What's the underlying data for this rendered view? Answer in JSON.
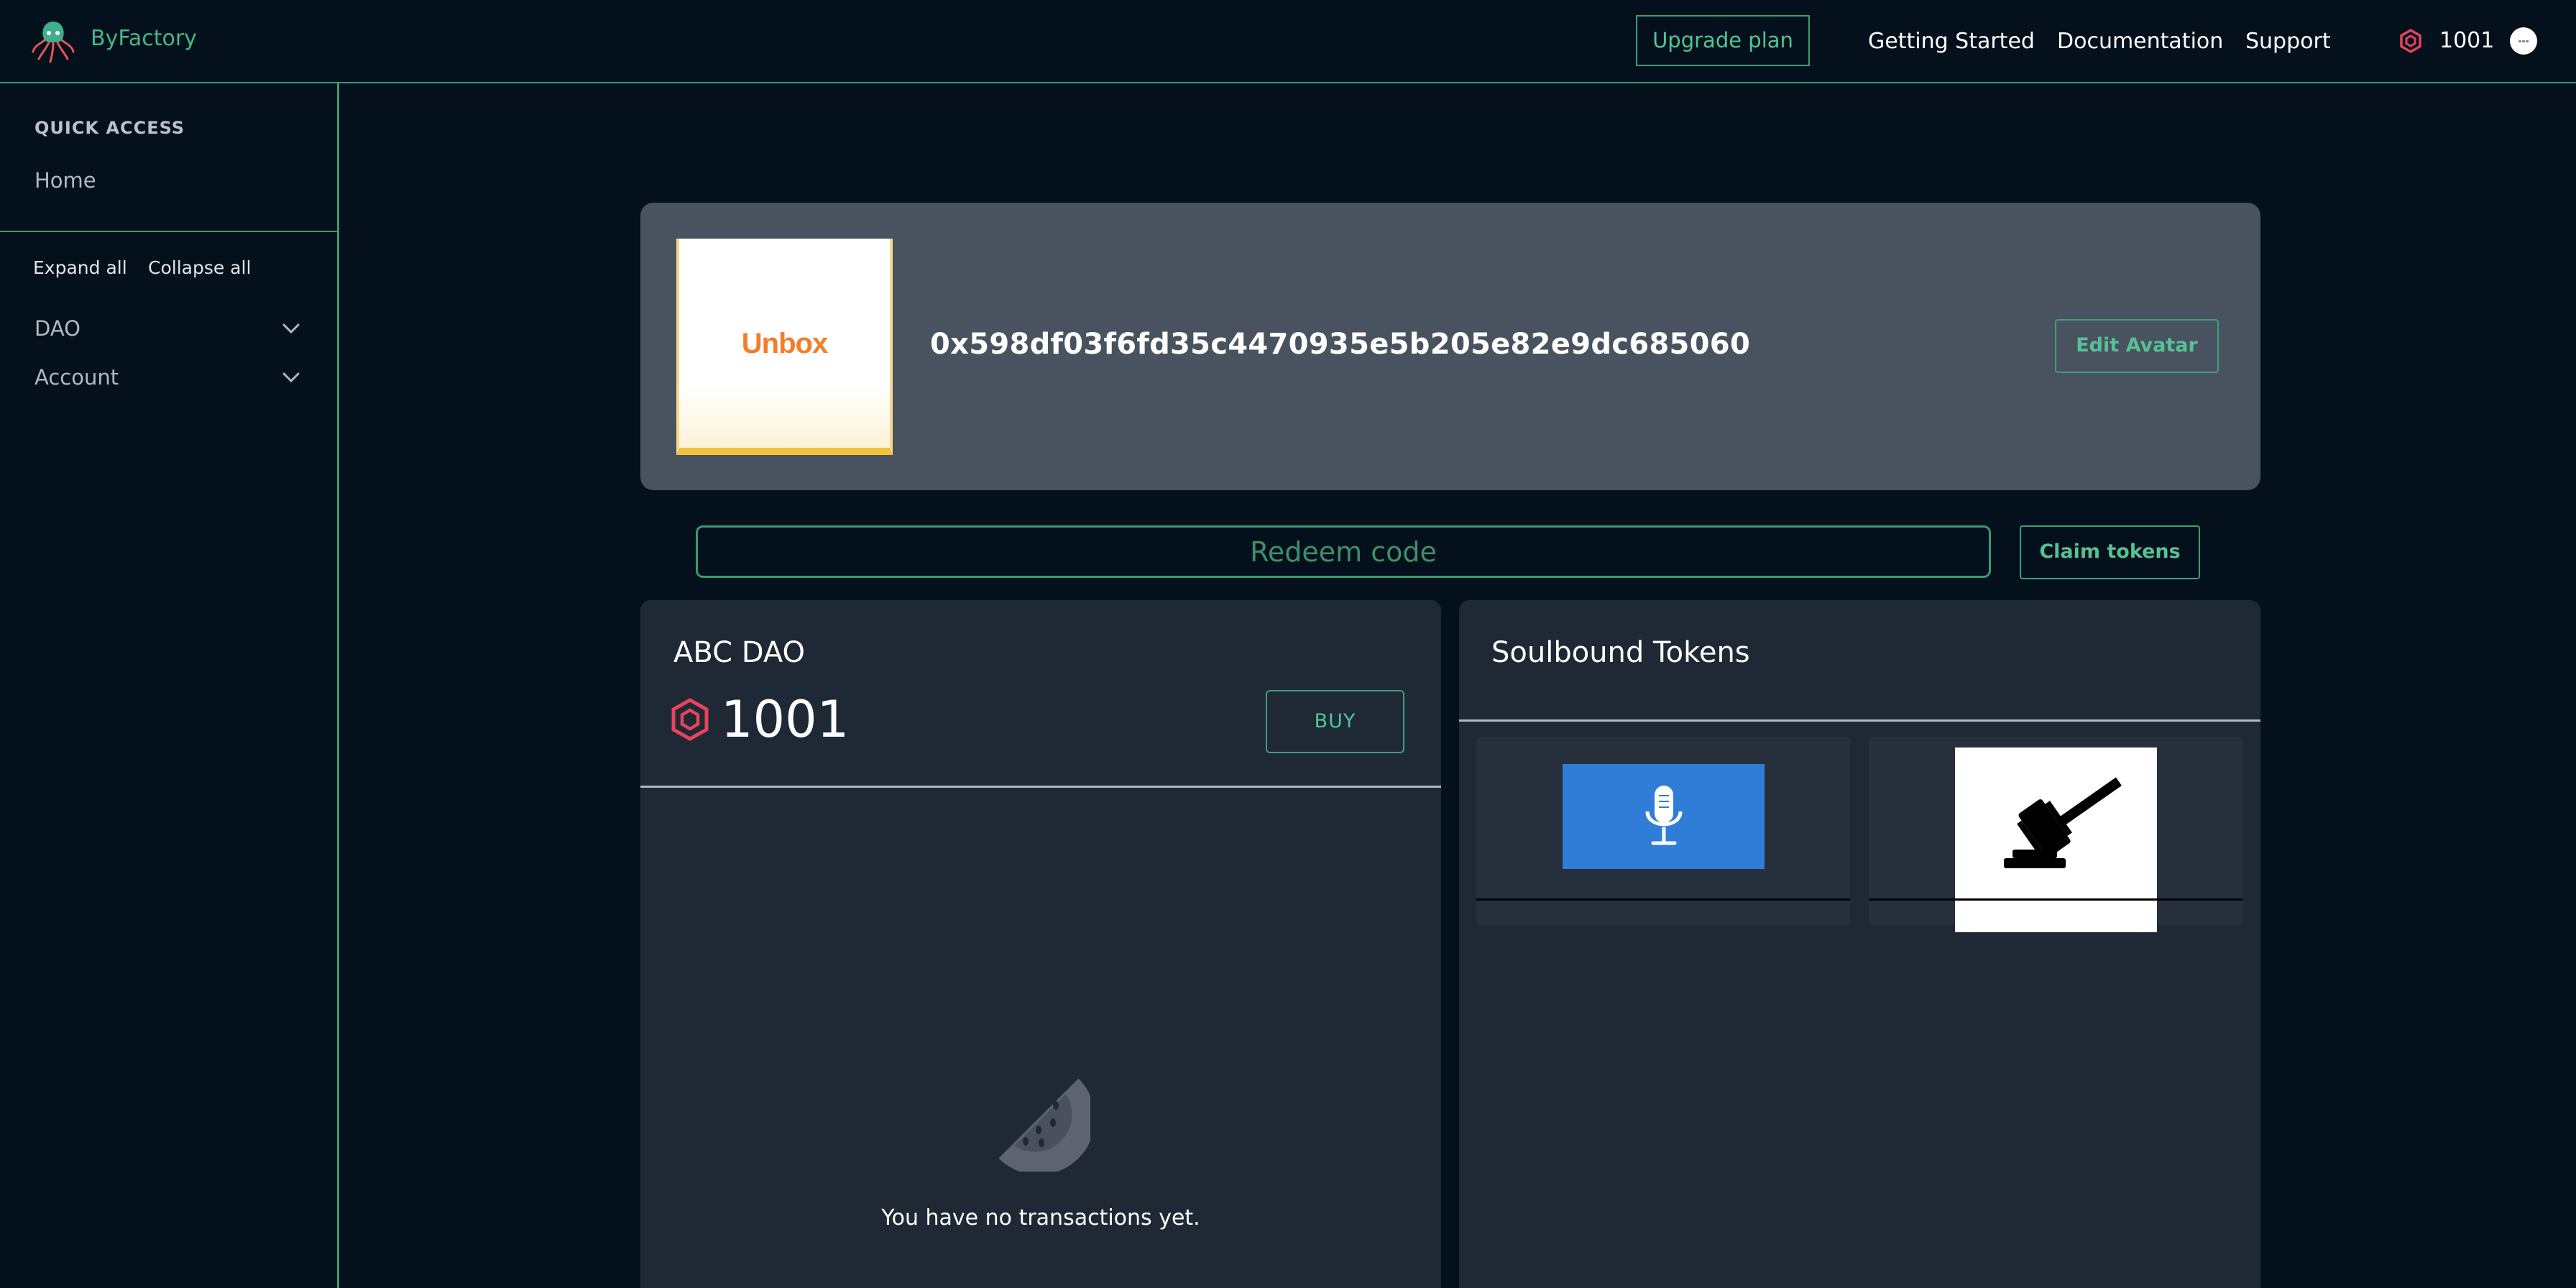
{
  "app": {
    "brand": "ByFactory",
    "upgrade_label": "Upgrade plan",
    "nav": [
      "Getting Started",
      "Documentation",
      "Support"
    ],
    "token_balance": "1001",
    "accent_color": "#3a9a72",
    "token_color": "#e8435c"
  },
  "sidebar": {
    "quick_access_title": "QUICK ACCESS",
    "home_label": "Home",
    "expand_all": "Expand all",
    "collapse_all": "Collapse all",
    "groups": [
      "DAO",
      "Account"
    ]
  },
  "profile": {
    "avatar_text": "Unbox",
    "address": "0x598df03f6fd35c4470935e5b205e82e9dc685060",
    "edit_avatar_label": "Edit Avatar"
  },
  "redeem": {
    "placeholder": "Redeem code",
    "claim_label": "Claim tokens"
  },
  "dao": {
    "name": "ABC DAO",
    "balance": "1001",
    "buy_label": "BUY",
    "empty_message": "You have no transactions yet."
  },
  "soulbound": {
    "title": "Soulbound Tokens",
    "tokens": [
      {
        "icon": "microphone-icon",
        "bg": "#2f7dd6"
      },
      {
        "icon": "gavel-icon",
        "bg": "#ffffff"
      }
    ]
  }
}
